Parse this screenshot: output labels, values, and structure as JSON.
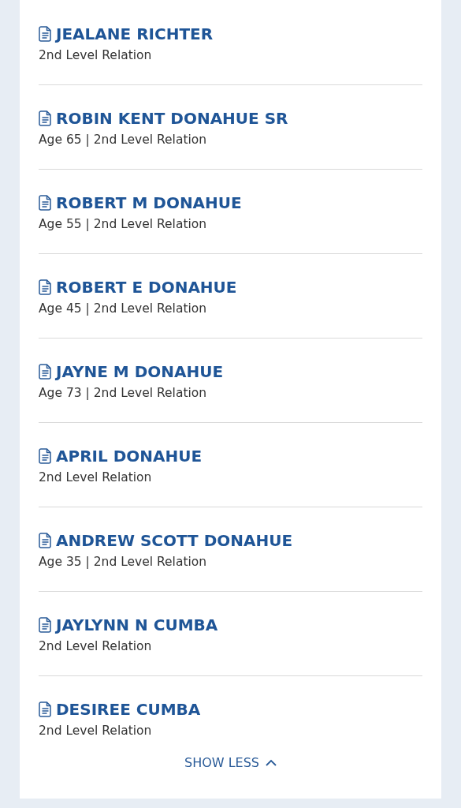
{
  "relations": [
    {
      "name": "JEALANE RICHTER",
      "detail": "2nd Level Relation"
    },
    {
      "name": "ROBIN KENT DONAHUE SR",
      "detail": "Age 65 | 2nd Level Relation"
    },
    {
      "name": "ROBERT M DONAHUE",
      "detail": "Age 55 | 2nd Level Relation"
    },
    {
      "name": "ROBERT E DONAHUE",
      "detail": "Age 45 | 2nd Level Relation"
    },
    {
      "name": "JAYNE M DONAHUE",
      "detail": "Age 73 | 2nd Level Relation"
    },
    {
      "name": "APRIL DONAHUE",
      "detail": "2nd Level Relation"
    },
    {
      "name": "ANDREW SCOTT DONAHUE",
      "detail": "Age 35 | 2nd Level Relation"
    },
    {
      "name": "JAYLYNN N CUMBA",
      "detail": "2nd Level Relation"
    },
    {
      "name": "DESIREE CUMBA",
      "detail": "2nd Level Relation"
    }
  ],
  "toggle": {
    "label": "SHOW LESS",
    "expanded": true
  }
}
